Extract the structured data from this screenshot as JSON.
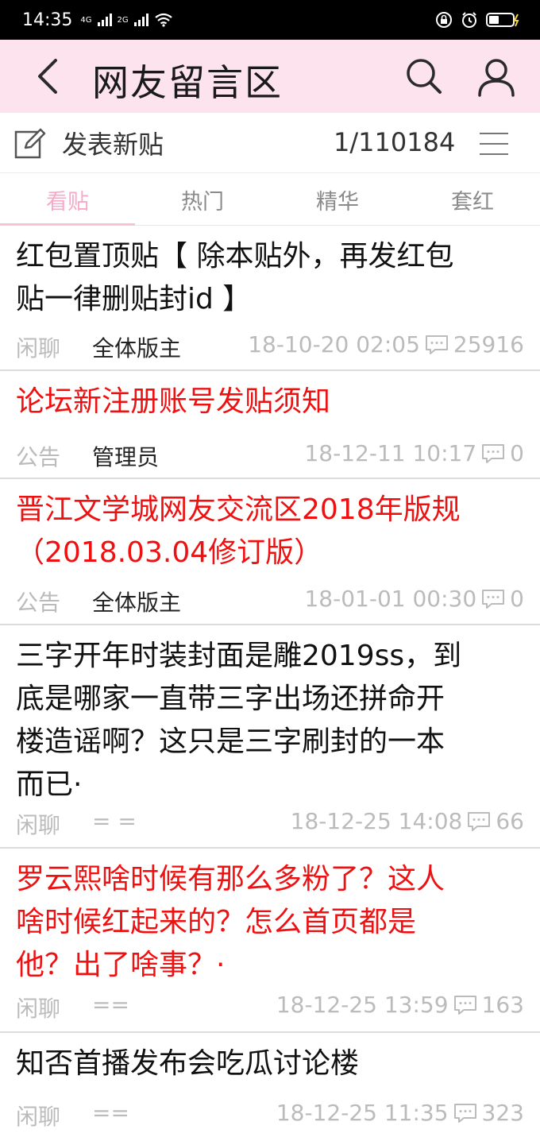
{
  "status_bar": {
    "time": "14:35",
    "network_1": "4G",
    "network_2": "2G"
  },
  "header": {
    "title": "网友留言区"
  },
  "toolbar": {
    "new_post_label": "发表新贴",
    "page_indicator": "1/110184"
  },
  "tabs": [
    {
      "label": "看贴",
      "active": true
    },
    {
      "label": "热门",
      "active": false
    },
    {
      "label": "精华",
      "active": false
    },
    {
      "label": "套红",
      "active": false
    }
  ],
  "colors": {
    "header_bg": "#fde3ee",
    "active_tab": "#f7a9c8",
    "red_title": "#ee1111"
  },
  "posts": [
    {
      "title_lines": [
        "红包置顶贴【 除本贴外，再发红包",
        "贴一律删贴封id 】"
      ],
      "highlight": false,
      "category": "闲聊",
      "author": "全体版主",
      "timestamp": "18-10-20 02:05",
      "comments": "25916"
    },
    {
      "title_lines": [
        "论坛新注册账号发贴须知"
      ],
      "highlight": true,
      "category": "公告",
      "author": "管理员",
      "timestamp": "18-12-11 10:17",
      "comments": "0"
    },
    {
      "title_lines": [
        "晋江文学城网友交流区2018年版规",
        "（2018.03.04修订版）"
      ],
      "highlight": true,
      "category": "公告",
      "author": "全体版主",
      "timestamp": "18-01-01 00:30",
      "comments": "0"
    },
    {
      "title_lines": [
        "三字开年时装封面是雕2019ss，到",
        "底是哪家一直带三字出场还拼命开",
        "楼造谣啊？这只是三字刷封的一本",
        "而已·"
      ],
      "highlight": false,
      "category": "闲聊",
      "author": "= =",
      "timestamp": "18-12-25 14:08",
      "comments": "66"
    },
    {
      "title_lines": [
        "罗云熙啥时候有那么多粉了？这人",
        "啥时候红起来的？怎么首页都是",
        "他？出了啥事？·"
      ],
      "highlight": true,
      "category": "闲聊",
      "author": "==",
      "timestamp": "18-12-25 13:59",
      "comments": "163"
    },
    {
      "title_lines": [
        "知否首播发布会吃瓜讨论楼"
      ],
      "highlight": false,
      "category": "闲聊",
      "author": "==",
      "timestamp": "18-12-25 11:35",
      "comments": "323"
    }
  ]
}
